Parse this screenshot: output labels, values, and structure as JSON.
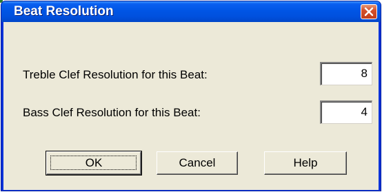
{
  "window": {
    "title": "Beat Resolution",
    "close_icon": "close-icon"
  },
  "form": {
    "treble": {
      "label": "Treble Clef Resolution for this Beat:",
      "value": "8"
    },
    "bass": {
      "label": "Bass Clef Resolution for this Beat:",
      "value": "4"
    }
  },
  "buttons": {
    "ok_label": "OK",
    "cancel_label": "Cancel",
    "help_label": "Help"
  },
  "colors": {
    "titlebar": "#0055e5",
    "client": "#ece9d8",
    "close_button": "#d4502a"
  }
}
